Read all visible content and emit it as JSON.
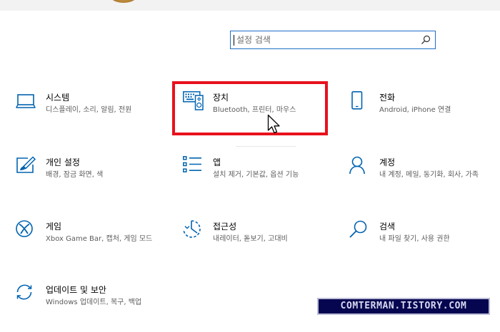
{
  "search": {
    "placeholder": "설정 검색"
  },
  "tiles": [
    {
      "title": "시스템",
      "desc": "디스플레이, 소리, 알림, 전원",
      "icon": "laptop-icon"
    },
    {
      "title": "장치",
      "desc": "Bluetooth, 프린터, 마우스",
      "icon": "keyboard-device-icon"
    },
    {
      "title": "전화",
      "desc": "Android, iPhone 연결",
      "icon": "phone-icon"
    },
    {
      "title": "개인 설정",
      "desc": "배경, 잠금 화면, 색",
      "icon": "personalization-icon"
    },
    {
      "title": "앱",
      "desc": "설치 제거, 기본값, 옵션 기능",
      "icon": "apps-list-icon"
    },
    {
      "title": "계정",
      "desc": "내 계정, 메일, 동기화, 회사, 가족",
      "icon": "person-icon"
    },
    {
      "title": "게임",
      "desc": "Xbox Game Bar, 캡처, 게임 모드",
      "icon": "xbox-icon"
    },
    {
      "title": "접근성",
      "desc": "내레이터, 돋보기, 고대비",
      "icon": "ease-of-access-icon"
    },
    {
      "title": "검색",
      "desc": "내 파일 찾기, 사용 권한",
      "icon": "search-icon"
    },
    {
      "title": "업데이트 및 보안",
      "desc": "Windows 업데이트, 복구, 백업",
      "icon": "update-sync-icon"
    }
  ],
  "watermark": {
    "text": "COMTERMAN.TISTORY.COM"
  },
  "colors": {
    "accent": "#0063b1",
    "highlight_border": "#e8111d",
    "watermark_bg": "#060650"
  }
}
